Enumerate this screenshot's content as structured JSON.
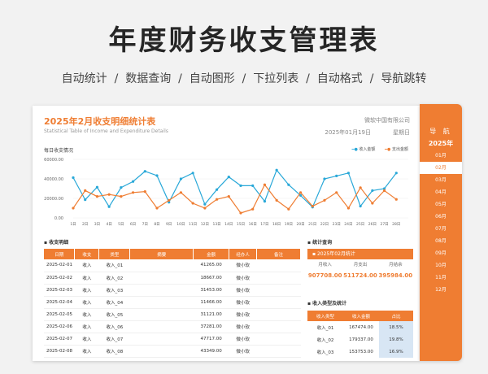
{
  "hero": {
    "title": "年度财务收支管理表",
    "features": [
      "自动统计",
      "数据查询",
      "自动图形",
      "下拉列表",
      "自动格式",
      "导航跳转"
    ],
    "separator": "  /  "
  },
  "sheet": {
    "title": "2025年2月收支明细统计表",
    "subtitle": "Statistical Table of Income and Expenditure Details",
    "company": "微软中国有限公司",
    "date": "2025年01月19日",
    "weekday": "星期日"
  },
  "nav": {
    "title": "导 航",
    "year": "2025年",
    "months": [
      "01月",
      "02月",
      "03月",
      "04月",
      "05月",
      "06月",
      "07月",
      "08月",
      "09月",
      "10月",
      "11月",
      "12月"
    ],
    "active_index": 1
  },
  "colors": {
    "accent": "#ef7d32",
    "income": "#29a8d8",
    "expense": "#ef7d32",
    "pct_bg": "#d8e6f4"
  },
  "chart_data": {
    "type": "line",
    "title": "每日收支情况",
    "x": [
      "1日",
      "2日",
      "3日",
      "4日",
      "5日",
      "6日",
      "7日",
      "8日",
      "9日",
      "10日",
      "11日",
      "12日",
      "13日",
      "14日",
      "15日",
      "16日",
      "17日",
      "18日",
      "19日",
      "20日",
      "21日",
      "22日",
      "23日",
      "24日",
      "25日",
      "26日",
      "27日",
      "28日",
      ""
    ],
    "ylim": [
      0,
      60000
    ],
    "yticks": [
      "60000.00",
      "40000.00",
      "20000.00",
      "0.00"
    ],
    "legend_position": "top-right",
    "series": [
      {
        "name": "收入金额",
        "color": "#29a8d8",
        "values": [
          41265,
          18667,
          31453,
          11466,
          31121,
          37281,
          47717,
          43349,
          16000,
          40000,
          46000,
          14000,
          29000,
          42000,
          33000,
          33000,
          17000,
          49000,
          34000,
          23000,
          11000,
          40000,
          43000,
          46000,
          12000,
          28000,
          30000,
          46000,
          null
        ]
      },
      {
        "name": "支出金额",
        "color": "#ef7d32",
        "values": [
          10000,
          28000,
          22000,
          24000,
          22000,
          26000,
          27000,
          10000,
          18000,
          26000,
          15000,
          10000,
          19000,
          22000,
          5000,
          9000,
          34000,
          18000,
          9000,
          26000,
          12000,
          18000,
          26000,
          10000,
          31000,
          15000,
          28000,
          19000,
          null
        ]
      }
    ]
  },
  "detail": {
    "section": "收支明细",
    "headers": [
      "日期",
      "收支",
      "类型",
      "摘要",
      "金额",
      "经办人",
      "备注"
    ],
    "rows": [
      [
        "2025-02-01",
        "收入",
        "收入_01",
        "",
        "41265.00",
        "微小软",
        ""
      ],
      [
        "2025-02-02",
        "收入",
        "收入_02",
        "",
        "18667.00",
        "微小软",
        ""
      ],
      [
        "2025-02-03",
        "收入",
        "收入_03",
        "",
        "31453.00",
        "微小软",
        ""
      ],
      [
        "2025-02-04",
        "收入",
        "收入_04",
        "",
        "11466.00",
        "微小软",
        ""
      ],
      [
        "2025-02-05",
        "收入",
        "收入_05",
        "",
        "31121.00",
        "微小软",
        ""
      ],
      [
        "2025-02-06",
        "收入",
        "收入_06",
        "",
        "37281.00",
        "微小软",
        ""
      ],
      [
        "2025-02-07",
        "收入",
        "收入_07",
        "",
        "47717.00",
        "微小软",
        ""
      ],
      [
        "2025-02-08",
        "收入",
        "收入_08",
        "",
        "43349.00",
        "微小软",
        ""
      ]
    ]
  },
  "stats": {
    "section": "统计查询",
    "query": "2025年02月统计",
    "labels": [
      "月收入",
      "月支出",
      "月结余"
    ],
    "values": [
      "907708.00",
      "511724.00",
      "395984.00"
    ]
  },
  "share": {
    "section": "收入类型及统计",
    "headers": [
      "收入类型",
      "收入金额",
      "占比"
    ],
    "rows": [
      [
        "收入_01",
        "167474.00",
        "18.5%"
      ],
      [
        "收入_02",
        "179337.00",
        "19.8%"
      ],
      [
        "收入_03",
        "153753.00",
        "16.9%"
      ]
    ]
  }
}
